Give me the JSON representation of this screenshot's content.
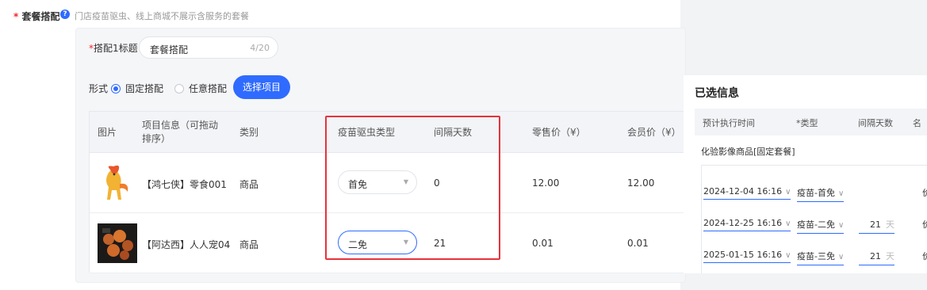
{
  "section": {
    "label": "套餐搭配",
    "hint": "门店疫苗驱虫、线上商城不展示含服务的套餐"
  },
  "combo": {
    "title_label": "搭配1标题",
    "title_value": "套餐搭配",
    "title_count": "4/20",
    "form_label": "形式",
    "radio_fixed": "固定搭配",
    "radio_any": "任意搭配",
    "select_btn": "选择项目"
  },
  "table": {
    "headers": [
      "图片",
      "项目信息（可拖动排序）",
      "类别",
      "疫苗驱虫类型",
      "间隔天数",
      "零售价（¥）",
      "会员价（¥）"
    ],
    "rows": [
      {
        "name": "【鸿七侠】零食001",
        "category": "商品",
        "type": "首免",
        "interval": "0",
        "retail": "12.00",
        "member": "12.00"
      },
      {
        "name": "【阿达西】人人宠04",
        "category": "商品",
        "type": "二免",
        "interval": "21",
        "retail": "0.01",
        "member": "0.01"
      }
    ]
  },
  "selected": {
    "title": "已选信息",
    "headers": [
      "预计执行时间",
      "*类型",
      "间隔天数",
      "名"
    ],
    "group": "化验影像商品[固定套餐]",
    "unit": "天",
    "rows": [
      {
        "time": "2024-12-04 16:16",
        "type": "疫苗-首免",
        "days": "",
        "cut": "价"
      },
      {
        "time": "2024-12-25 16:16",
        "type": "疫苗-二免",
        "days": "21",
        "cut": "价"
      },
      {
        "time": "2025-01-15 16:16",
        "type": "疫苗-三免",
        "days": "21",
        "cut": "价"
      }
    ]
  },
  "colors": {
    "accent": "#2f6bff",
    "highlight": "#e8323c",
    "required": "#f5222d"
  }
}
